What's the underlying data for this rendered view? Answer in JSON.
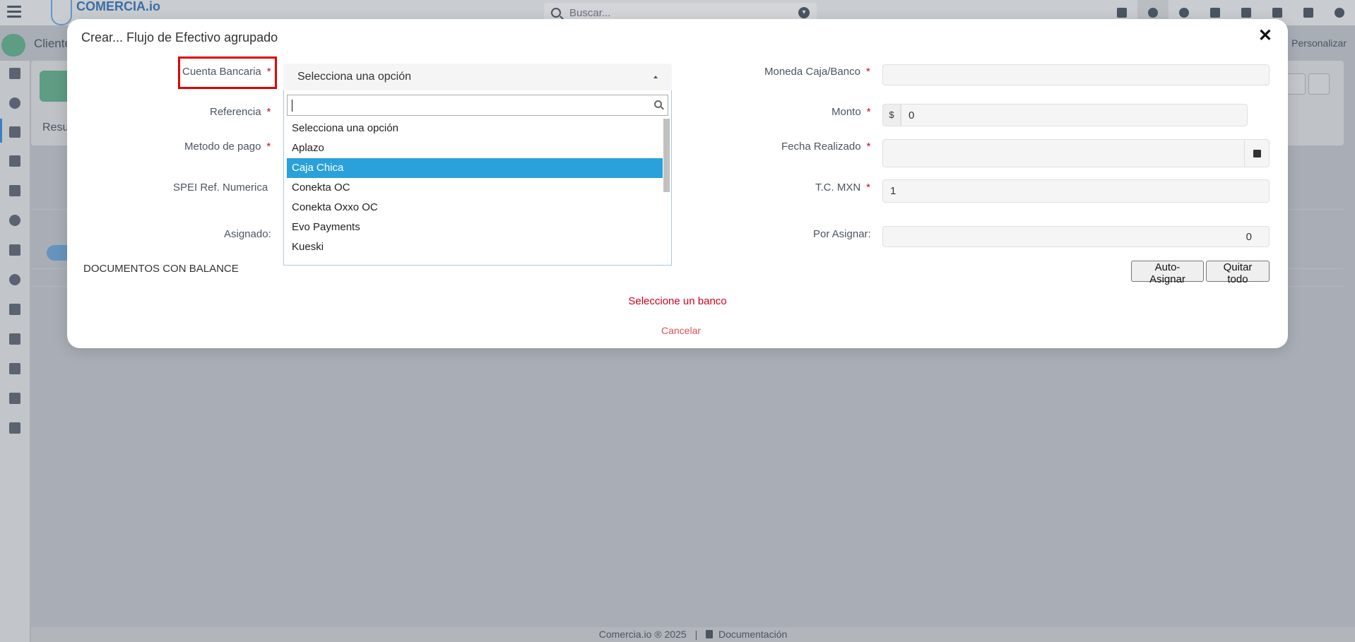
{
  "app": {
    "logo_text": "COMERCIA.io",
    "search_placeholder": "Buscar...",
    "subbar_title": "Cliente",
    "personalizar_label": "Personalizar",
    "bg_tab_label": "Resu",
    "footer_text": "Comercia.io ® 2025",
    "footer_separator": "|",
    "footer_link": "Documentación"
  },
  "modal": {
    "title": "Crear... Flujo de Efectivo agrupado",
    "close_label": "✕",
    "required_mark": "*",
    "left": {
      "cuenta_bancaria_label": "Cuenta Bancaria",
      "cuenta_bancaria_value": "Selecciona una opción",
      "referencia_label": "Referencia",
      "metodo_pago_label": "Metodo de pago",
      "spei_label": "SPEI Ref. Numerica",
      "asignado_label": "Asignado:"
    },
    "dropdown": {
      "search_value": "",
      "options": [
        "Selecciona una opción",
        "Aplazo",
        "Caja Chica",
        "Conekta OC",
        "Conekta Oxxo OC",
        "Evo Payments",
        "Kueski"
      ],
      "highlighted_option": "Caja Chica"
    },
    "right": {
      "moneda_label": "Moneda Caja/Banco",
      "moneda_value": "",
      "monto_label": "Monto",
      "monto_prefix": "$",
      "monto_value": "0",
      "fecha_label": "Fecha Realizado",
      "fecha_value": "",
      "tc_label": "T.C. MXN",
      "tc_value": "1",
      "por_asignar_label": "Por Asignar:",
      "por_asignar_value": "0"
    },
    "section_label": "DOCUMENTOS CON BALANCE",
    "auto_asignar_label": "Auto-Asignar",
    "quitar_todo_label": "Quitar todo",
    "warning_text": "Seleccione un banco",
    "cancel_label": "Cancelar"
  },
  "colors": {
    "accent": "#2aa1da",
    "required": "#d0021b",
    "highlight_border": "#e00000"
  }
}
